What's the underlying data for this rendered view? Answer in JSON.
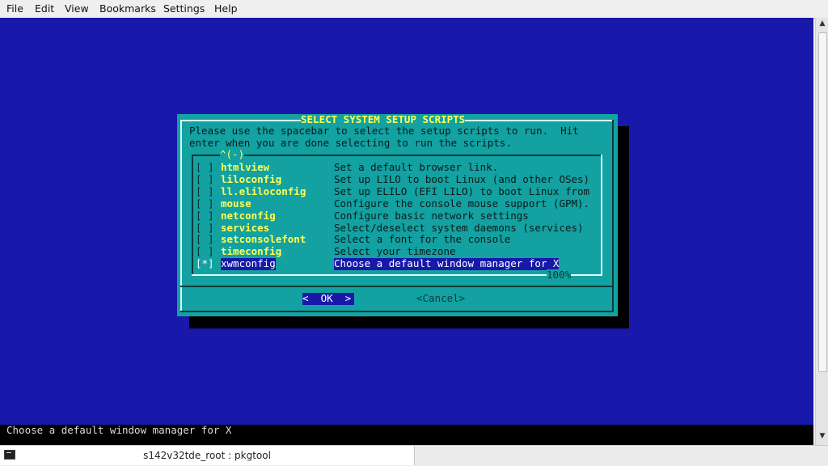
{
  "menu": {
    "items": [
      "File",
      "Edit",
      "View",
      "Bookmarks",
      "Settings",
      "Help"
    ]
  },
  "dialog": {
    "title": "SELECT SYSTEM SETUP SCRIPTS",
    "instructions": [
      "Please use the spacebar to select the setup scripts to run.  Hit",
      "enter when you are done selecting to run the scripts."
    ],
    "scroll_indicator": "^(-)",
    "percent": "100%",
    "items": [
      {
        "check": "[ ]",
        "name": "htmlview",
        "desc": "Set a default browser link."
      },
      {
        "check": "[ ]",
        "name": "liloconfig",
        "desc": "Set up LILO to boot Linux (and other OSes)"
      },
      {
        "check": "[ ]",
        "name": "ll.eliloconfig",
        "desc": "Set up ELILO (EFI LILO) to boot Linux from"
      },
      {
        "check": "[ ]",
        "name": "mouse",
        "desc": "Configure the console mouse support (GPM)."
      },
      {
        "check": "[ ]",
        "name": "netconfig",
        "desc": "Configure basic network settings"
      },
      {
        "check": "[ ]",
        "name": "services",
        "desc": "Select/deselect system daemons (services)"
      },
      {
        "check": "[ ]",
        "name": "setconsolefont",
        "desc": "Select a font for the console"
      },
      {
        "check": "[ ]",
        "name": "timeconfig",
        "desc": "Select your timezone"
      },
      {
        "check": "[*]",
        "name": "xwmconfig",
        "desc": "Choose a default window manager for X"
      }
    ],
    "ok_label": "<  OK  >",
    "cancel_label": "<Cancel>"
  },
  "status_line": "Choose a default window manager for X",
  "taskbar": {
    "window_title": "s142v32tde_root : pkgtool"
  },
  "colors": {
    "terminal_bg": "#1818aa",
    "dialog_bg": "#13a1a1",
    "highlight": "#ffff55"
  }
}
